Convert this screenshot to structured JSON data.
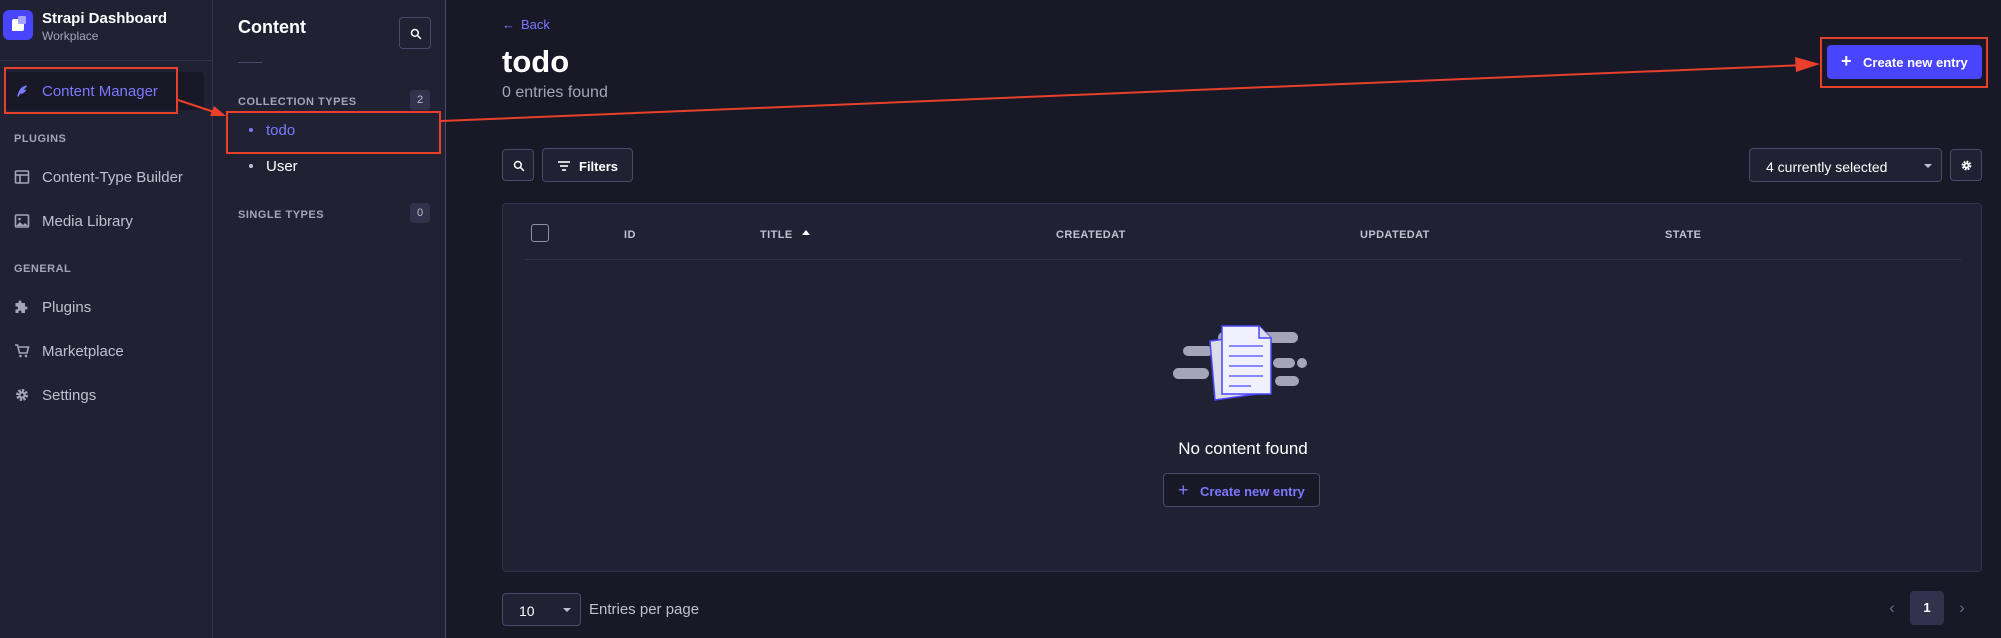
{
  "brand": {
    "title": "Strapi Dashboard",
    "subtitle": "Workplace"
  },
  "mainnav": {
    "active_item": {
      "label": "Content Manager",
      "icon": "feather-icon"
    },
    "sections": [
      {
        "title": "PLUGINS",
        "items": [
          {
            "label": "Content-Type Builder",
            "icon": "layout-icon"
          },
          {
            "label": "Media Library",
            "icon": "image-icon"
          }
        ]
      },
      {
        "title": "GENERAL",
        "items": [
          {
            "label": "Plugins",
            "icon": "puzzle-icon"
          },
          {
            "label": "Marketplace",
            "icon": "cart-icon"
          },
          {
            "label": "Settings",
            "icon": "gear-icon"
          }
        ]
      }
    ]
  },
  "subnav": {
    "title": "Content",
    "collection_types": {
      "title": "COLLECTION TYPES",
      "count": "2",
      "items": [
        {
          "label": "todo",
          "active": true
        },
        {
          "label": "User",
          "active": false
        }
      ]
    },
    "single_types": {
      "title": "SINGLE TYPES",
      "count": "0"
    }
  },
  "header": {
    "back_label": "Back",
    "title": "todo",
    "subtitle": "0 entries found",
    "create_label": "Create new entry"
  },
  "toolbar": {
    "filters_label": "Filters",
    "columns_select_value": "4 currently selected"
  },
  "table": {
    "columns": [
      "ID",
      "TITLE",
      "CREATEDAT",
      "UPDATEDAT",
      "STATE"
    ],
    "sorted_column": "TITLE",
    "sort_direction": "ascending",
    "empty_text": "No content found",
    "empty_action_label": "Create new entry"
  },
  "pagination": {
    "page_size": "10",
    "page_size_label": "Entries per page",
    "current_page": "1",
    "prev_glyph": "‹",
    "next_glyph": "›"
  },
  "colors": {
    "accent": "#4945ff",
    "accent_text": "#7b79ff",
    "annotation": "#e8402a",
    "background": "#181826",
    "panel": "#212134"
  }
}
